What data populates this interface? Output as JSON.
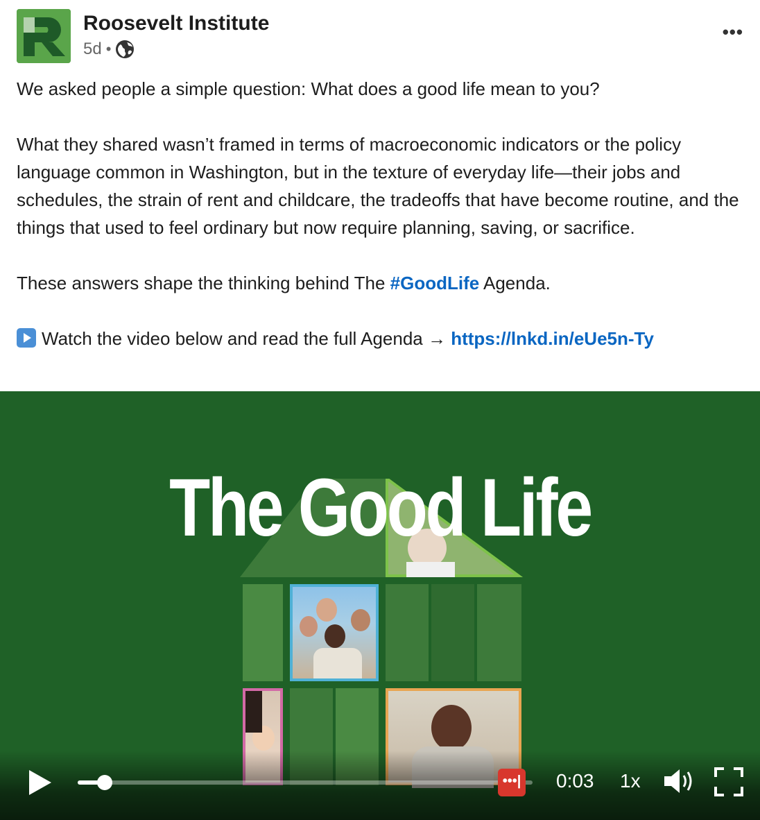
{
  "author": {
    "name": "Roosevelt Institute",
    "time": "5d",
    "separator": "•",
    "visibility_icon": "globe-icon",
    "logo_letter": "R",
    "logo_color": "#5aa54a"
  },
  "more_menu": {
    "label": "•••",
    "icon": "more-horizontal-icon"
  },
  "post": {
    "line1": "We asked people a simple question: What does a good life mean to you?",
    "para2": "What they shared wasn’t framed in terms of macroeconomic indicators or the policy language common in Washington, but in the texture of everyday life—their jobs and schedules, the strain of rent and childcare, the tradeoffs that have become routine, and the things that used to feel ordinary but now require planning, saving, or sacrifice.",
    "para3_before": "These answers shape the thinking behind The ",
    "hashtag": "#GoodLife",
    "para3_after": " Agenda.",
    "para4_text": "Watch the video below and read the full Agenda → ",
    "link": "https://lnkd.in/eUe5n-Ty",
    "link_color": "#0a66c2"
  },
  "video": {
    "title": "The Good Life",
    "background": "#1f6127",
    "progress": 0.06,
    "time": "0:03",
    "speed": "1x",
    "badge_label": "•••|",
    "badge_color": "#d8372d",
    "play_icon": "play-icon",
    "volume_icon": "volume-icon",
    "fullscreen_icon": "fullscreen-icon"
  }
}
